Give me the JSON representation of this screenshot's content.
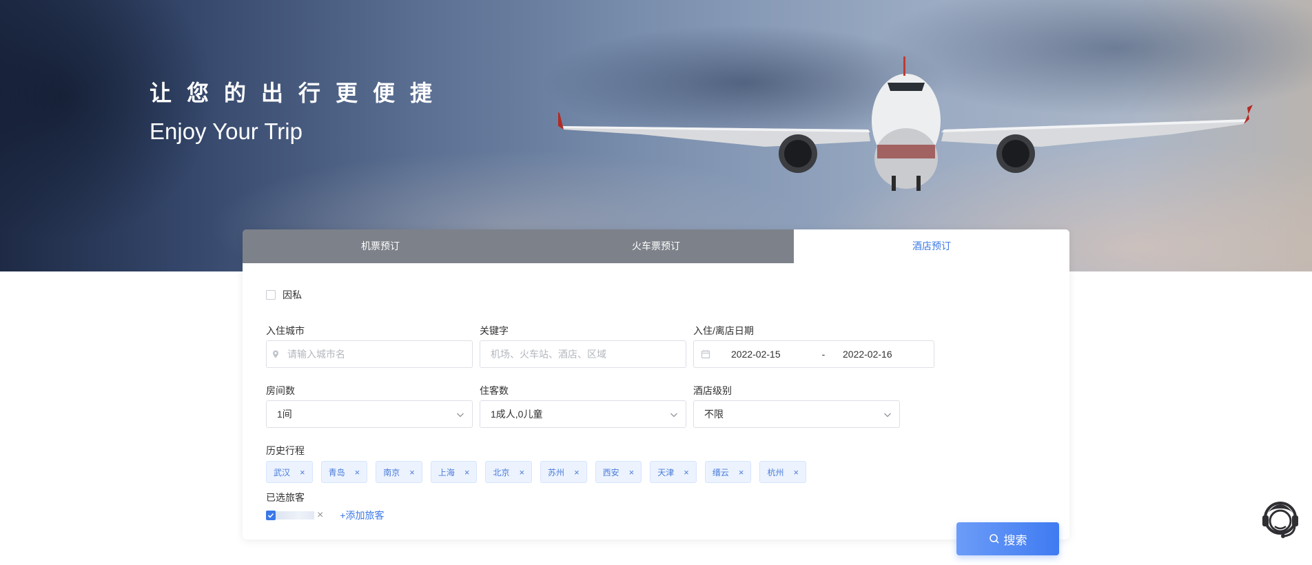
{
  "hero": {
    "title": "让您的出行更便捷",
    "subtitle": "Enjoy Your Trip"
  },
  "tabs": [
    {
      "label": "机票预订",
      "active": false
    },
    {
      "label": "火车票预订",
      "active": false
    },
    {
      "label": "酒店预订",
      "active": true
    }
  ],
  "form": {
    "private_label": "因私",
    "private_checked": false,
    "city": {
      "label": "入住城市",
      "placeholder": "请输入城市名",
      "icon": "location-pin-icon"
    },
    "keyword": {
      "label": "关键字",
      "placeholder": "机场、火车站、酒店、区域"
    },
    "dates": {
      "label": "入住/离店日期",
      "checkin": "2022-02-15",
      "separator": "-",
      "checkout": "2022-02-16",
      "icon": "calendar-icon"
    },
    "rooms": {
      "label": "房间数",
      "value": "1间"
    },
    "guests": {
      "label": "住客数",
      "value": "1成人,0儿童"
    },
    "level": {
      "label": "酒店级别",
      "value": "不限"
    },
    "history_label": "历史行程",
    "history": [
      "武汉",
      "青岛",
      "南京",
      "上海",
      "北京",
      "苏州",
      "西安",
      "天津",
      "缙云",
      "杭州"
    ],
    "travelers_label": "已选旅客",
    "add_traveler": "+添加旅客",
    "traveler_checked": true
  },
  "search_button": "搜索",
  "colors": {
    "accent": "#3a78e8",
    "tag_bg": "#ecf3ff",
    "tab_inactive": "#5d636b"
  }
}
